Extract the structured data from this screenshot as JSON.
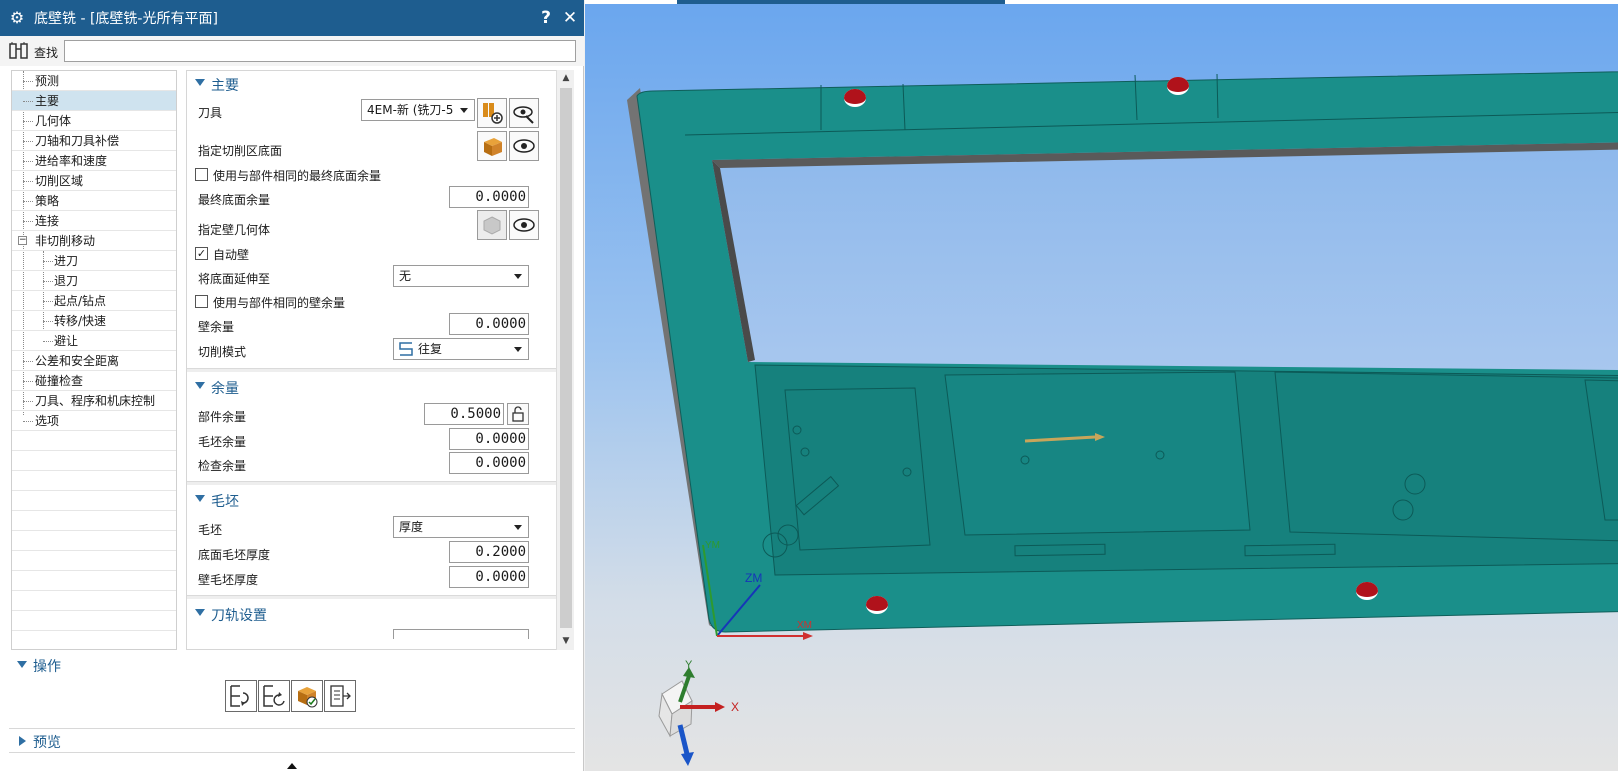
{
  "dialog": {
    "title": "底壁铣 - [底壁铣-光所有平面]",
    "help_label": "?",
    "close_label": "✕",
    "find_label": "查找",
    "find_value": ""
  },
  "tree": {
    "items": [
      {
        "label": "预测"
      },
      {
        "label": "主要"
      },
      {
        "label": "几何体"
      },
      {
        "label": "刀轴和刀具补偿"
      },
      {
        "label": "进给率和速度"
      },
      {
        "label": "切削区域"
      },
      {
        "label": "策略"
      },
      {
        "label": "连接"
      },
      {
        "label": "非切削移动"
      },
      {
        "label": "进刀"
      },
      {
        "label": "退刀"
      },
      {
        "label": "起点/钻点"
      },
      {
        "label": "转移/快速"
      },
      {
        "label": "避让"
      },
      {
        "label": "公差和安全距离"
      },
      {
        "label": "碰撞检查"
      },
      {
        "label": "刀具、程序和机床控制"
      },
      {
        "label": "选项"
      }
    ],
    "expander": "−"
  },
  "main": {
    "section_title": "主要",
    "tool_label": "刀具",
    "tool_value": "4EM-新 (铣刀-5",
    "cut_floor_label": "指定切削区底面",
    "use_part_floor_label": "使用与部件相同的最终底面余量",
    "final_floor_label": "最终底面余量",
    "final_floor_value": "0.0000",
    "wall_geom_label": "指定壁几何体",
    "auto_wall_label": "自动壁",
    "auto_wall_checked": true,
    "extend_floor_label": "将底面延伸至",
    "extend_floor_value": "无",
    "use_part_wall_label": "使用与部件相同的壁余量",
    "wall_stock_label": "壁余量",
    "wall_stock_value": "0.0000",
    "cut_pattern_label": "切削模式",
    "cut_pattern_value": "往复"
  },
  "stock": {
    "section_title": "余量",
    "part_label": "部件余量",
    "part_value": "0.5000",
    "blank_label": "毛坯余量",
    "blank_value": "0.0000",
    "check_label": "检查余量",
    "check_value": "0.0000"
  },
  "blank": {
    "section_title": "毛坯",
    "blank_label": "毛坯",
    "blank_value": "厚度",
    "floor_thick_label": "底面毛坯厚度",
    "floor_thick_value": "0.2000",
    "wall_thick_label": "壁毛坯厚度",
    "wall_thick_value": "0.0000"
  },
  "path_settings": {
    "section_title": "刀轨设置"
  },
  "operations": {
    "section_title": "操作"
  },
  "preview": {
    "section_title": "预览"
  },
  "viewport": {
    "csys_labels": {
      "zm": "ZM",
      "ym": "YM",
      "xm": "XM"
    },
    "triad_labels": {
      "x": "X",
      "y": "Y"
    }
  },
  "colors": {
    "title_bar": "#1e5d8f",
    "section_text": "#1e5d8f",
    "part_face": "#1a8f8a",
    "part_side": "#737373",
    "selected_row": "#cfe3ef",
    "hole_red": "#b0121b"
  },
  "icons": [
    "gear-icon",
    "binoculars-icon",
    "tool-new-icon",
    "eye-wrench-icon",
    "floor-select-icon",
    "display-icon",
    "wall-geom-icon",
    "zigzag-pattern-icon",
    "lock-icon",
    "generate-icon",
    "replay-icon",
    "verify-icon",
    "list-icon"
  ]
}
